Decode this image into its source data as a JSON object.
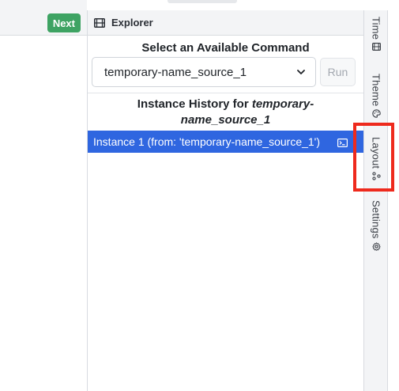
{
  "toolbar": {
    "next_label": "Next"
  },
  "explorer": {
    "title": "Explorer",
    "command_heading": "Select an Available Command",
    "selected_command": "temporary-name_source_1",
    "run_label": "Run",
    "history_prefix": "Instance History for ",
    "history_source_line1": "temporary-",
    "history_source_line2": "name_source_1",
    "instances": [
      {
        "label": "Instance 1 (from: 'temporary-name_source_1')"
      }
    ]
  },
  "sidebar": {
    "tabs": [
      {
        "label": "Time",
        "icon": "film-icon"
      },
      {
        "label": "Theme",
        "icon": "palette-icon"
      },
      {
        "label": "Layout",
        "icon": "layout-nodes-icon"
      },
      {
        "label": "Settings",
        "icon": "gear-icon"
      }
    ]
  },
  "colors": {
    "accent_green": "#3ea363",
    "selection_blue": "#2f66e0",
    "highlight_red": "#ee2a1d"
  }
}
